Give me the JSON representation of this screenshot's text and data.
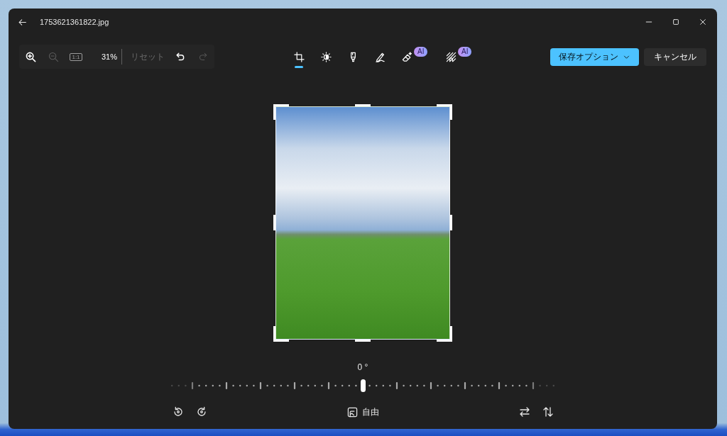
{
  "window": {
    "title": "1753621361822.jpg"
  },
  "toolbar": {
    "zoom_buttons": [
      {
        "kind": "zoom_in",
        "disabled": false
      },
      {
        "kind": "zoom_out",
        "disabled": true
      },
      {
        "kind": "actual_size",
        "label": "1:1",
        "disabled": true
      }
    ],
    "zoom_level": "31%",
    "reset": {
      "label": "リセット",
      "disabled": true
    },
    "history_buttons": [
      {
        "kind": "undo",
        "disabled": false
      },
      {
        "kind": "redo",
        "disabled": true
      }
    ]
  },
  "edit_tools": [
    {
      "kind": "crop",
      "selected": true
    },
    {
      "kind": "adjust",
      "selected": false
    },
    {
      "kind": "filter",
      "selected": false
    },
    {
      "kind": "markup",
      "selected": false
    },
    {
      "kind": "erase",
      "selected": false,
      "badge": "AI"
    },
    {
      "kind": "background",
      "selected": false,
      "badge": "AI"
    }
  ],
  "actions": {
    "save": {
      "label": "保存オプション"
    },
    "cancel": {
      "label": "キャンセル"
    }
  },
  "crop": {
    "angle": "0 °",
    "level": 0.5,
    "rotate_buttons": [
      {
        "kind": "rotate_left"
      },
      {
        "kind": "rotate_right"
      }
    ],
    "aspect_ratio": {
      "label": "自由"
    },
    "flip_buttons": [
      {
        "kind": "flip_horizontal"
      },
      {
        "kind": "flip_vertical"
      }
    ]
  }
}
